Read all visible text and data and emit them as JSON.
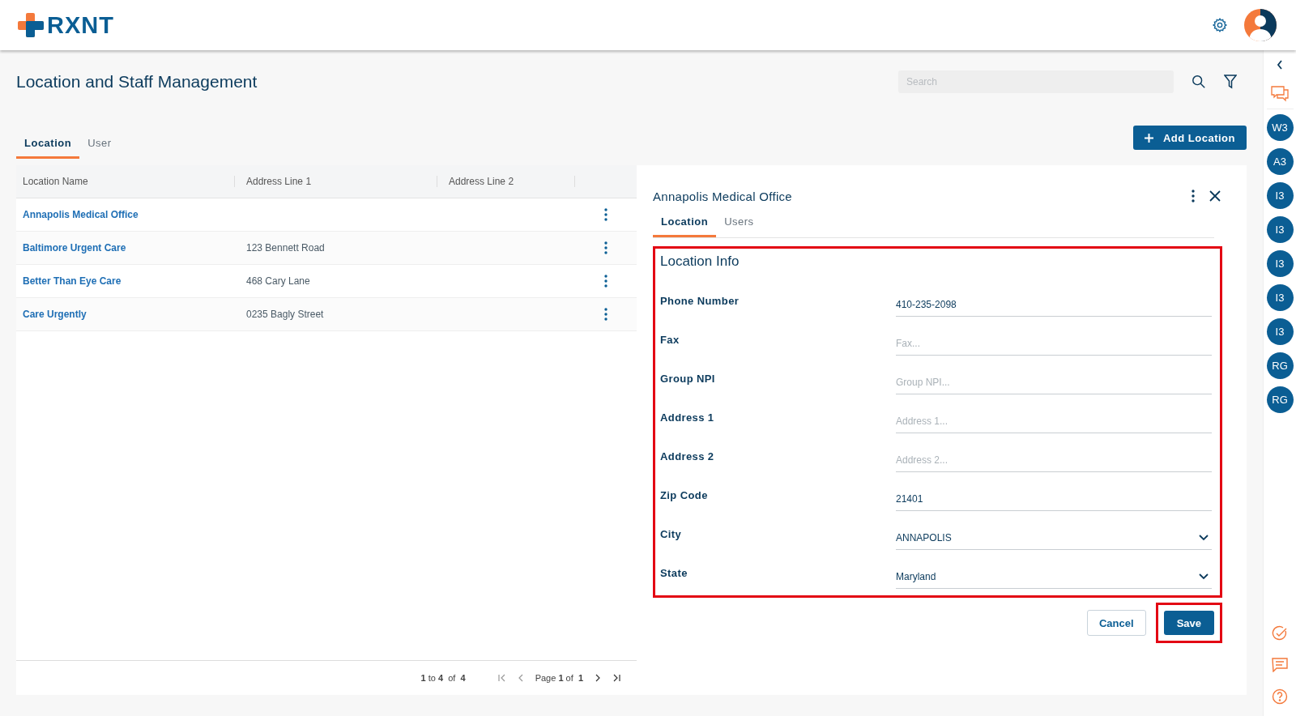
{
  "header": {
    "logo": "RXNT"
  },
  "page": {
    "title": "Location and Staff Management",
    "search": {
      "placeholder": "Search"
    }
  },
  "tabs": [
    {
      "label": "Location",
      "selected": true
    },
    {
      "label": "User",
      "selected": false
    }
  ],
  "add_button": "Add Location",
  "table": {
    "columns": [
      "Location Name",
      "Address Line 1",
      "Address Line 2"
    ],
    "rows": [
      {
        "name": "Annapolis Medical Office",
        "address1": "",
        "address2": ""
      },
      {
        "name": "Baltimore Urgent Care",
        "address1": "123 Bennett Road",
        "address2": ""
      },
      {
        "name": "Better Than Eye Care",
        "address1": "468 Cary Lane",
        "address2": ""
      },
      {
        "name": "Care Urgently",
        "address1": "0235 Bagly Street",
        "address2": ""
      }
    ],
    "pagination": {
      "from": "1",
      "to_word": "to",
      "to": "4",
      "of_word": "of",
      "total": "4",
      "page_word": "Page",
      "page": "1",
      "page_of": "of",
      "pages": "1"
    }
  },
  "detail": {
    "title": "Annapolis Medical Office",
    "tabs": [
      {
        "label": "Location",
        "selected": true
      },
      {
        "label": "Users",
        "selected": false
      }
    ],
    "section": {
      "title": "Location Info",
      "highlighted": true
    },
    "fields": [
      {
        "kind": "text",
        "label": "Phone Number",
        "value": "410-235-2098"
      },
      {
        "kind": "text",
        "label": "Fax",
        "placeholder": "Fax..."
      },
      {
        "kind": "text",
        "label": "Group NPI",
        "placeholder": "Group NPI..."
      },
      {
        "kind": "text",
        "label": "Address 1",
        "placeholder": "Address 1..."
      },
      {
        "kind": "text",
        "label": "Address 2",
        "placeholder": "Address 2..."
      },
      {
        "kind": "text",
        "label": "Zip Code",
        "value": "21401"
      },
      {
        "kind": "select",
        "label": "City",
        "value": "ANNAPOLIS"
      },
      {
        "kind": "select",
        "label": "State",
        "value": "Maryland"
      }
    ],
    "cancel": "Cancel",
    "save": {
      "label": "Save",
      "highlighted": true
    }
  },
  "sidebar": {
    "avatars": [
      "W3",
      "A3",
      "I3",
      "I3",
      "I3",
      "I3",
      "I3",
      "RG",
      "RG"
    ]
  }
}
